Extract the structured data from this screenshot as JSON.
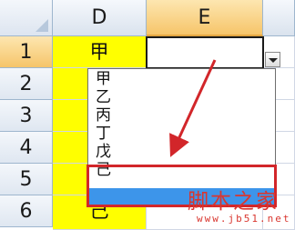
{
  "columns": [
    "D",
    "E"
  ],
  "rows": [
    "1",
    "2",
    "3",
    "4",
    "5",
    "6"
  ],
  "cells": {
    "d1": "甲",
    "d6": "己"
  },
  "dropdown": {
    "options": [
      "甲",
      "乙",
      "丙",
      "丁",
      "戊",
      "己",
      ""
    ],
    "selected_index": 6
  },
  "watermark": {
    "text": "脚本之家",
    "url": "www.jb51.net"
  },
  "colors": {
    "highlight_column": "#ffff00",
    "selection_blue": "#3d95ea",
    "annotation_red": "#d2262a",
    "active_header": "#f6c56a"
  }
}
